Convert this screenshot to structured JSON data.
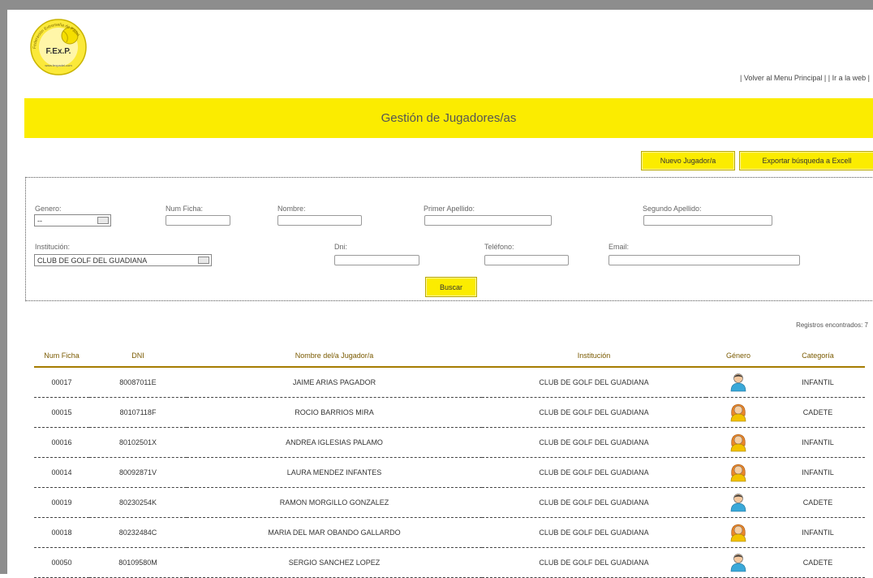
{
  "logo": {
    "ring_text": "Federación Extremeña de Pádel",
    "initials": "F.Ex.P.",
    "url": "www.fexpadel.com"
  },
  "top_links": {
    "back": "| Volver al Menu Principal |",
    "web": "| Ir a la web |"
  },
  "page_title": "Gestión de Jugadores/as",
  "buttons": {
    "new_player": "Nuevo Jugador/a",
    "export": "Exportar búsqueda a Excell",
    "search": "Buscar"
  },
  "filters": {
    "genero": {
      "label": "Genero:",
      "value": "--"
    },
    "num_ficha": {
      "label": "Num Ficha:",
      "value": ""
    },
    "nombre": {
      "label": "Nombre:",
      "value": ""
    },
    "primer_apellido": {
      "label": "Primer Apellido:",
      "value": ""
    },
    "segundo_apellido": {
      "label": "Segundo Apellido:",
      "value": ""
    },
    "institucion": {
      "label": "Institución:",
      "value": "CLUB DE GOLF DEL GUADIANA"
    },
    "dni": {
      "label": "Dni:",
      "value": ""
    },
    "telefono": {
      "label": "Teléfono:",
      "value": ""
    },
    "email": {
      "label": "Email:",
      "value": ""
    }
  },
  "records_found": "Registros encontrados: 7",
  "table": {
    "headers": {
      "num_ficha": "Num Ficha",
      "dni": "DNI",
      "nombre": "Nombre del/a Jugador/a",
      "institucion": "Institución",
      "genero": "Género",
      "categoria": "Categoría"
    },
    "rows": [
      {
        "num_ficha": "00017",
        "dni": "80087011E",
        "nombre": "JAIME ARIAS PAGADOR",
        "institucion": "CLUB DE GOLF DEL GUADIANA",
        "genero": "male",
        "categoria": "INFANTIL"
      },
      {
        "num_ficha": "00015",
        "dni": "80107118F",
        "nombre": "ROCIO BARRIOS MIRA",
        "institucion": "CLUB DE GOLF DEL GUADIANA",
        "genero": "female",
        "categoria": "CADETE"
      },
      {
        "num_ficha": "00016",
        "dni": "80102501X",
        "nombre": "ANDREA IGLESIAS PALAMO",
        "institucion": "CLUB DE GOLF DEL GUADIANA",
        "genero": "female",
        "categoria": "INFANTIL"
      },
      {
        "num_ficha": "00014",
        "dni": "80092871V",
        "nombre": "LAURA MENDEZ INFANTES",
        "institucion": "CLUB DE GOLF DEL GUADIANA",
        "genero": "female",
        "categoria": "INFANTIL"
      },
      {
        "num_ficha": "00019",
        "dni": "80230254K",
        "nombre": "RAMON MORGILLO GONZALEZ",
        "institucion": "CLUB DE GOLF DEL GUADIANA",
        "genero": "male",
        "categoria": "CADETE"
      },
      {
        "num_ficha": "00018",
        "dni": "80232484C",
        "nombre": "MARIA DEL MAR OBANDO GALLARDO",
        "institucion": "CLUB DE GOLF DEL GUADIANA",
        "genero": "female",
        "categoria": "INFANTIL"
      },
      {
        "num_ficha": "00050",
        "dni": "80109580M",
        "nombre": "SERGIO SANCHEZ LOPEZ",
        "institucion": "CLUB DE GOLF DEL GUADIANA",
        "genero": "male",
        "categoria": "CADETE"
      }
    ]
  },
  "colors": {
    "accent_yellow": "#fbec00",
    "header_brown": "#a57c00",
    "male_icon": "#3aa8d8",
    "female_icon": "#e8862a"
  }
}
